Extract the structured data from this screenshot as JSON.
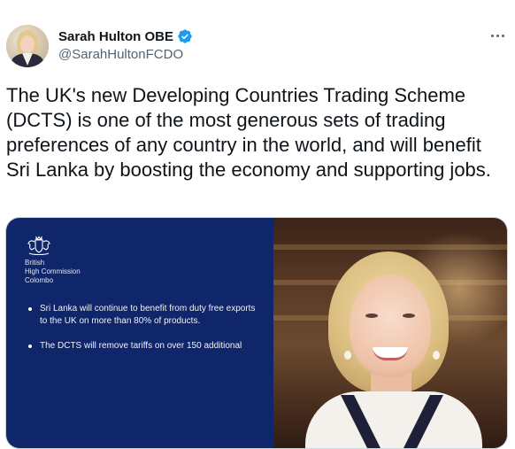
{
  "tweet": {
    "author": {
      "display_name": "Sarah Hulton OBE",
      "handle": "@SarahHultonFCDO",
      "verified": true
    },
    "text": "The UK's new Developing Countries Trading Scheme (DCTS) is one of the most generous sets of trading preferences of any country in the world, and will benefit Sri Lanka by boosting the economy and supporting jobs."
  },
  "media": {
    "organization": [
      "British",
      "High Commission",
      "Colombo"
    ],
    "bullets": [
      "Sri Lanka will continue to benefit from duty free exports to the UK on more than 80% of products.",
      "The DCTS will remove tariffs on over 150 additional"
    ]
  },
  "colors": {
    "panel_background": "#10266a",
    "verified_badge": "#1d9bf0",
    "secondary_text": "#536471"
  },
  "icons": {
    "verified": "verified-badge-icon",
    "more": "more-options-icon",
    "crest": "royal-crest-icon"
  }
}
